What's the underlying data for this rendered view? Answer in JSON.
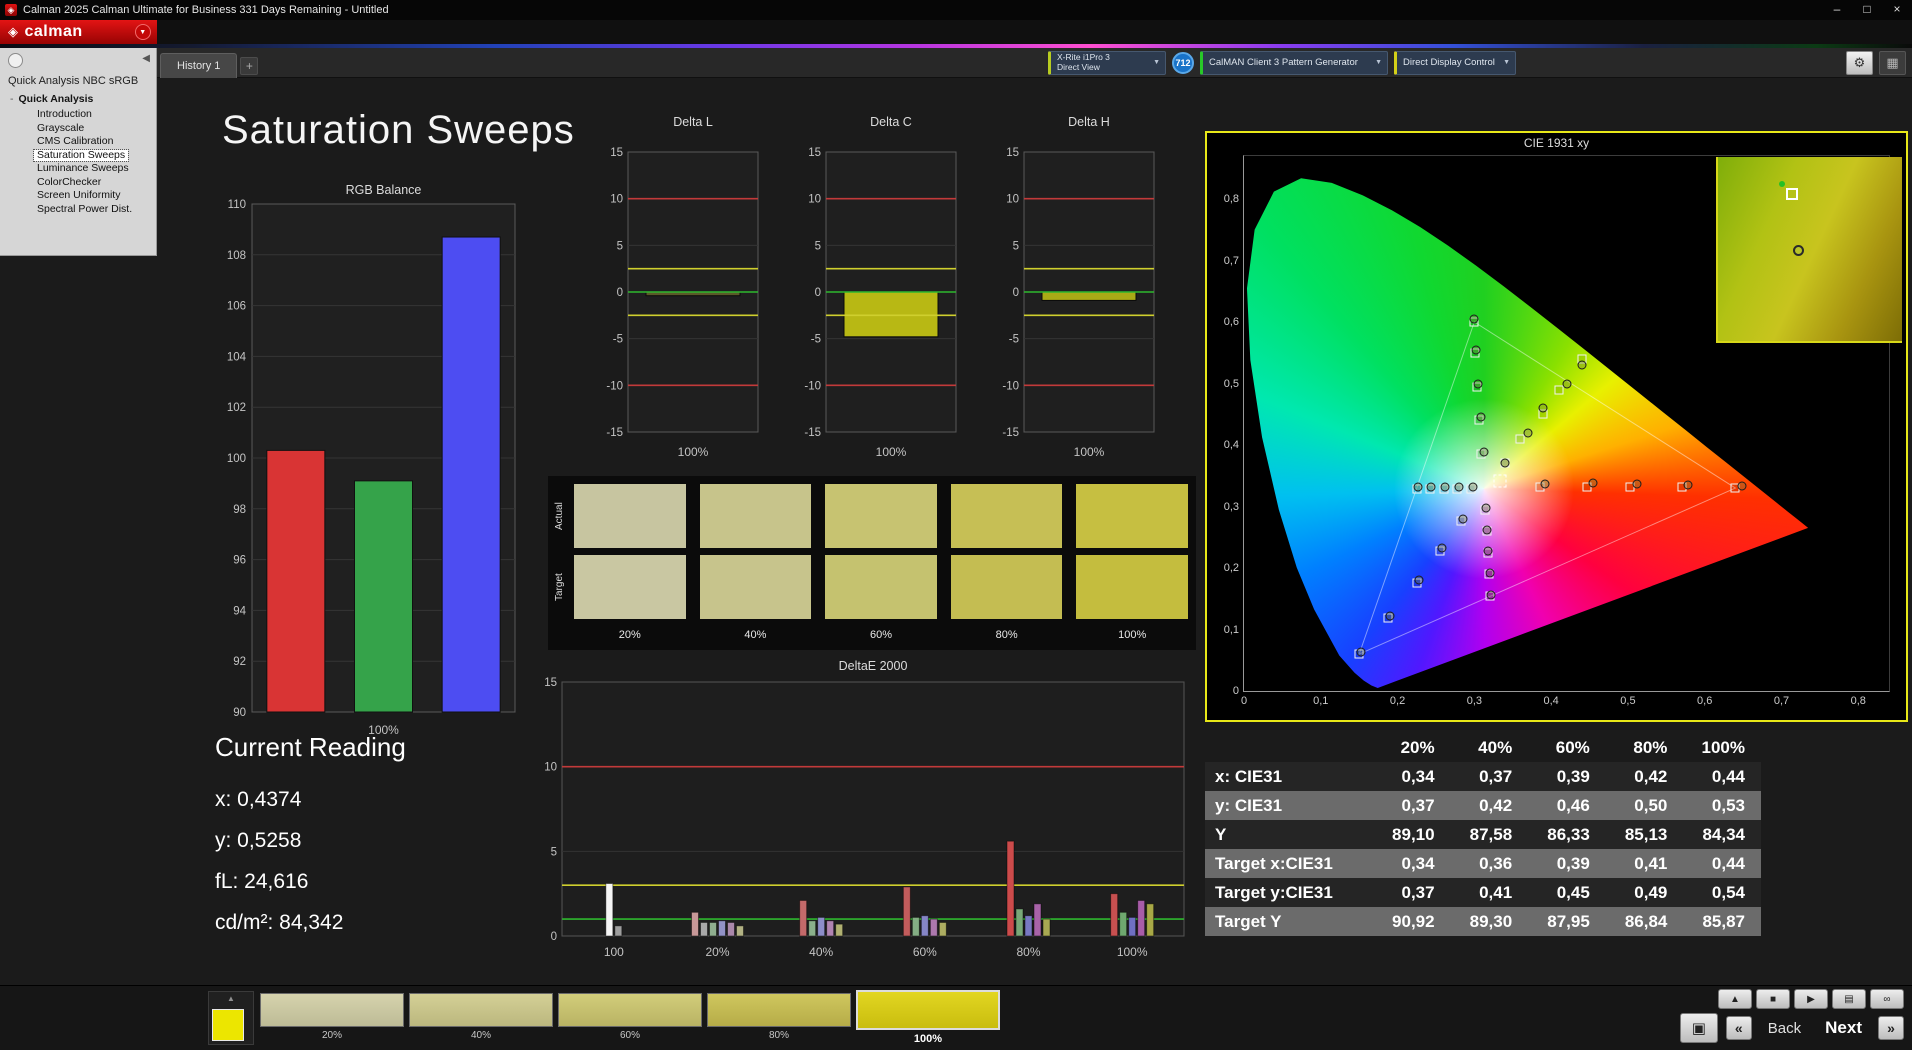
{
  "window": {
    "title": "Calman 2025 Calman Ultimate for Business 331 Days Remaining  - Untitled",
    "controls": {
      "minimize": "–",
      "maximize": "□",
      "close": "×"
    }
  },
  "brand": {
    "logo_icon": "◈",
    "logo_text": "calman"
  },
  "ui": {
    "caret": "▼",
    "collapse": "◀",
    "gear": "⚙",
    "grid": "▦"
  },
  "toolbar": {
    "tabs": [
      {
        "label": "History 1",
        "active": true
      }
    ],
    "add_tab": "+",
    "meter": {
      "line1": "X-Rite i1Pro 3",
      "line2": "Direct View"
    },
    "badge": "712",
    "pattern_generator": "CalMAN Client 3 Pattern Generator",
    "display_control": "Direct Display Control"
  },
  "sidebar": {
    "title": "Quick Analysis NBC sRGB",
    "expander": "-",
    "root": "Quick Analysis",
    "items": [
      {
        "label": "Introduction",
        "selected": false
      },
      {
        "label": "Grayscale",
        "selected": false
      },
      {
        "label": "CMS Calibration",
        "selected": false
      },
      {
        "label": "Saturation Sweeps",
        "selected": true
      },
      {
        "label": "Luminance Sweeps",
        "selected": false
      },
      {
        "label": "ColorChecker",
        "selected": false
      },
      {
        "label": "Screen Uniformity",
        "selected": false
      },
      {
        "label": "Spectral Power Dist.",
        "selected": false
      }
    ]
  },
  "page": {
    "title": "Saturation Sweeps"
  },
  "current_reading": {
    "title": "Current Reading",
    "x": "x: 0,4374",
    "y": "y: 0,5258",
    "fl": "fL: 24,616",
    "cdm2": "cd/m²: 84,342"
  },
  "patches": {
    "row_labels": [
      "Actual",
      "Target"
    ],
    "col_labels": [
      "20%",
      "40%",
      "60%",
      "80%",
      "100%"
    ],
    "actual_colors": [
      "#c7c5a0",
      "#c7c48b",
      "#c7c371",
      "#c6bf55",
      "#c6bf41"
    ],
    "target_colors": [
      "#c9c7a2",
      "#c7c48c",
      "#c5c26f",
      "#c4bd52",
      "#c4bd3e"
    ]
  },
  "table": {
    "headers": [
      "",
      "20%",
      "40%",
      "60%",
      "80%",
      "100%"
    ],
    "rows": [
      {
        "label": "x: CIE31",
        "values": [
          "0,34",
          "0,37",
          "0,39",
          "0,42",
          "0,44"
        ]
      },
      {
        "label": "y: CIE31",
        "values": [
          "0,37",
          "0,42",
          "0,46",
          "0,50",
          "0,53"
        ]
      },
      {
        "label": "Y",
        "values": [
          "89,10",
          "87,58",
          "86,33",
          "85,13",
          "84,34"
        ]
      },
      {
        "label": "Target x:CIE31",
        "values": [
          "0,34",
          "0,36",
          "0,39",
          "0,41",
          "0,44"
        ]
      },
      {
        "label": "Target y:CIE31",
        "values": [
          "0,37",
          "0,41",
          "0,45",
          "0,49",
          "0,54"
        ]
      },
      {
        "label": "Target Y",
        "values": [
          "90,92",
          "89,30",
          "87,95",
          "86,84",
          "85,87"
        ]
      }
    ]
  },
  "bottom_bar": {
    "preview_color": "#ece600",
    "swatches": [
      {
        "label": "20%",
        "color_top": "#d6d3ad",
        "color": "#bdbb96",
        "selected": false
      },
      {
        "label": "40%",
        "color_top": "#d4d096",
        "color": "#bbb77e",
        "selected": false
      },
      {
        "label": "60%",
        "color_top": "#d2cd7a",
        "color": "#b9b364",
        "selected": false
      },
      {
        "label": "80%",
        "color_top": "#cfc75e",
        "color": "#b6ac48",
        "selected": false
      },
      {
        "label": "100%",
        "color_top": "#e2d622",
        "color": "#c9bd0e",
        "selected": true
      }
    ],
    "controls": {
      "eject": "▲",
      "stop": "■",
      "play": "▶",
      "save": "▤",
      "loop": "∞",
      "window": "▣",
      "prev": "«",
      "next": "»"
    },
    "back_label": "Back",
    "next_label": "Next"
  },
  "chart_data": [
    {
      "id": "rgb_balance",
      "type": "bar",
      "title": "RGB Balance",
      "categories": [
        "Red",
        "Green",
        "Blue"
      ],
      "values": [
        100.3,
        99.1,
        108.7
      ],
      "colors": [
        "#d93434",
        "#35a34a",
        "#4d4df2"
      ],
      "xlabel": "100%",
      "ylim": [
        90,
        110
      ],
      "ytick_step": 2
    },
    {
      "id": "delta_l",
      "type": "bar",
      "title": "Delta L",
      "categories": [
        "100%"
      ],
      "values": [
        -0.4
      ],
      "bar_color": "#5a5a28",
      "xlabel": "100%",
      "ylim": [
        -15,
        15
      ],
      "ytick_step": 5,
      "ref_lines": [
        {
          "y": 10,
          "color": "#c23a3a"
        },
        {
          "y": -10,
          "color": "#c23a3a"
        },
        {
          "y": 2.5,
          "color": "#cfcf2e"
        },
        {
          "y": -2.5,
          "color": "#cfcf2e"
        },
        {
          "y": 0,
          "color": "#2eb82e"
        }
      ]
    },
    {
      "id": "delta_c",
      "type": "bar",
      "title": "Delta C",
      "categories": [
        "100%"
      ],
      "values": [
        -4.8
      ],
      "bar_color": "#b8b814",
      "xlabel": "100%",
      "ylim": [
        -15,
        15
      ],
      "ytick_step": 5,
      "ref_lines": [
        {
          "y": 10,
          "color": "#c23a3a"
        },
        {
          "y": -10,
          "color": "#c23a3a"
        },
        {
          "y": 2.5,
          "color": "#cfcf2e"
        },
        {
          "y": -2.5,
          "color": "#cfcf2e"
        },
        {
          "y": 0,
          "color": "#2eb82e"
        }
      ]
    },
    {
      "id": "delta_h",
      "type": "bar",
      "title": "Delta H",
      "categories": [
        "100%"
      ],
      "values": [
        -0.9
      ],
      "bar_color": "#aaaa16",
      "xlabel": "100%",
      "ylim": [
        -15,
        15
      ],
      "ytick_step": 5,
      "ref_lines": [
        {
          "y": 10,
          "color": "#c23a3a"
        },
        {
          "y": -10,
          "color": "#c23a3a"
        },
        {
          "y": 2.5,
          "color": "#cfcf2e"
        },
        {
          "y": -2.5,
          "color": "#cfcf2e"
        },
        {
          "y": 0,
          "color": "#2eb82e"
        }
      ]
    },
    {
      "id": "delta_e2000",
      "type": "bar",
      "title": "DeltaE 2000",
      "ylim": [
        0,
        15
      ],
      "yticks": [
        0,
        5,
        10,
        15
      ],
      "x_labels": [
        "100",
        "20%",
        "40%",
        "60%",
        "80%",
        "100%"
      ],
      "ref_lines": [
        {
          "y": 10,
          "color": "#c23a3a"
        },
        {
          "y": 3,
          "color": "#cfcf2e"
        },
        {
          "y": 1,
          "color": "#2eb82e"
        }
      ],
      "groups": [
        [
          [
            "#f5f5f5",
            3.1
          ],
          [
            "#9e9e9e",
            0.6
          ]
        ],
        [
          [
            "#c89898",
            1.4
          ],
          [
            "#a8a8a8",
            0.8
          ],
          [
            "#8fae8f",
            0.8
          ],
          [
            "#9292c6",
            0.9
          ],
          [
            "#aa88aa",
            0.8
          ],
          [
            "#b2b284",
            0.6
          ]
        ],
        [
          [
            "#c46a6a",
            2.1
          ],
          [
            "#8bb08b",
            0.9
          ],
          [
            "#8d8dc9",
            1.1
          ],
          [
            "#b184b1",
            0.9
          ],
          [
            "#b1b172",
            0.7
          ]
        ],
        [
          [
            "#c25c5c",
            2.9
          ],
          [
            "#84ad84",
            1.1
          ],
          [
            "#8585c6",
            1.2
          ],
          [
            "#ad78ad",
            1.0
          ],
          [
            "#adad62",
            0.8
          ]
        ],
        [
          [
            "#cc4b4b",
            5.6
          ],
          [
            "#78a878",
            1.6
          ],
          [
            "#7878c2",
            1.2
          ],
          [
            "#a863a8",
            1.9
          ],
          [
            "#a8a852",
            1.0
          ]
        ],
        [
          [
            "#c85050",
            2.5
          ],
          [
            "#6fa86f",
            1.4
          ],
          [
            "#6f6fc2",
            1.1
          ],
          [
            "#a85ca8",
            2.1
          ],
          [
            "#a8a846",
            1.9
          ]
        ]
      ]
    },
    {
      "id": "cie",
      "type": "scatter",
      "title": "CIE 1931 xy",
      "xlim": [
        0,
        0.84
      ],
      "ylim": [
        0,
        0.87
      ],
      "white_point": [
        0.3127,
        0.329
      ],
      "triangle": [
        [
          0.64,
          0.33
        ],
        [
          0.3,
          0.6
        ],
        [
          0.15,
          0.06
        ]
      ],
      "cursor": [
        0.333,
        0.342
      ],
      "x_tick_labels": [
        "0",
        "0,1",
        "0,2",
        "0,3",
        "0,4",
        "0,5",
        "0,6",
        "0,7",
        "0,8"
      ],
      "y_tick_labels": [
        "0",
        "0,1",
        "0,2",
        "0,3",
        "0,4",
        "0,5",
        "0,6",
        "0,7",
        "0,8"
      ],
      "targets": [
        [
          0.385,
          0.331
        ],
        [
          0.447,
          0.332
        ],
        [
          0.503,
          0.332
        ],
        [
          0.57,
          0.331
        ],
        [
          0.64,
          0.33
        ],
        [
          0.309,
          0.385
        ],
        [
          0.306,
          0.44
        ],
        [
          0.303,
          0.495
        ],
        [
          0.301,
          0.55
        ],
        [
          0.3,
          0.6
        ],
        [
          0.283,
          0.277
        ],
        [
          0.255,
          0.228
        ],
        [
          0.225,
          0.176
        ],
        [
          0.188,
          0.118
        ],
        [
          0.15,
          0.06
        ],
        [
          0.296,
          0.329
        ],
        [
          0.278,
          0.329
        ],
        [
          0.26,
          0.329
        ],
        [
          0.242,
          0.329
        ],
        [
          0.225,
          0.329
        ],
        [
          0.3145,
          0.295
        ],
        [
          0.316,
          0.26
        ],
        [
          0.3175,
          0.225
        ],
        [
          0.319,
          0.19
        ],
        [
          0.321,
          0.154
        ],
        [
          0.34,
          0.37
        ],
        [
          0.36,
          0.41
        ],
        [
          0.39,
          0.45
        ],
        [
          0.41,
          0.49
        ],
        [
          0.44,
          0.54
        ]
      ],
      "measured": [
        [
          0.392,
          0.336
        ],
        [
          0.455,
          0.338
        ],
        [
          0.512,
          0.337
        ],
        [
          0.578,
          0.335
        ],
        [
          0.648,
          0.334
        ],
        [
          0.312,
          0.388
        ],
        [
          0.308,
          0.445
        ],
        [
          0.305,
          0.5
        ],
        [
          0.302,
          0.555
        ],
        [
          0.3,
          0.605
        ],
        [
          0.285,
          0.28
        ],
        [
          0.258,
          0.232
        ],
        [
          0.228,
          0.18
        ],
        [
          0.19,
          0.122
        ],
        [
          0.153,
          0.064
        ],
        [
          0.298,
          0.331
        ],
        [
          0.28,
          0.331
        ],
        [
          0.262,
          0.331
        ],
        [
          0.244,
          0.331
        ],
        [
          0.226,
          0.331
        ],
        [
          0.315,
          0.297
        ],
        [
          0.317,
          0.262
        ],
        [
          0.318,
          0.227
        ],
        [
          0.32,
          0.192
        ],
        [
          0.322,
          0.156
        ],
        [
          0.34,
          0.37
        ],
        [
          0.37,
          0.42
        ],
        [
          0.39,
          0.46
        ],
        [
          0.42,
          0.5
        ],
        [
          0.44,
          0.53
        ]
      ]
    }
  ]
}
